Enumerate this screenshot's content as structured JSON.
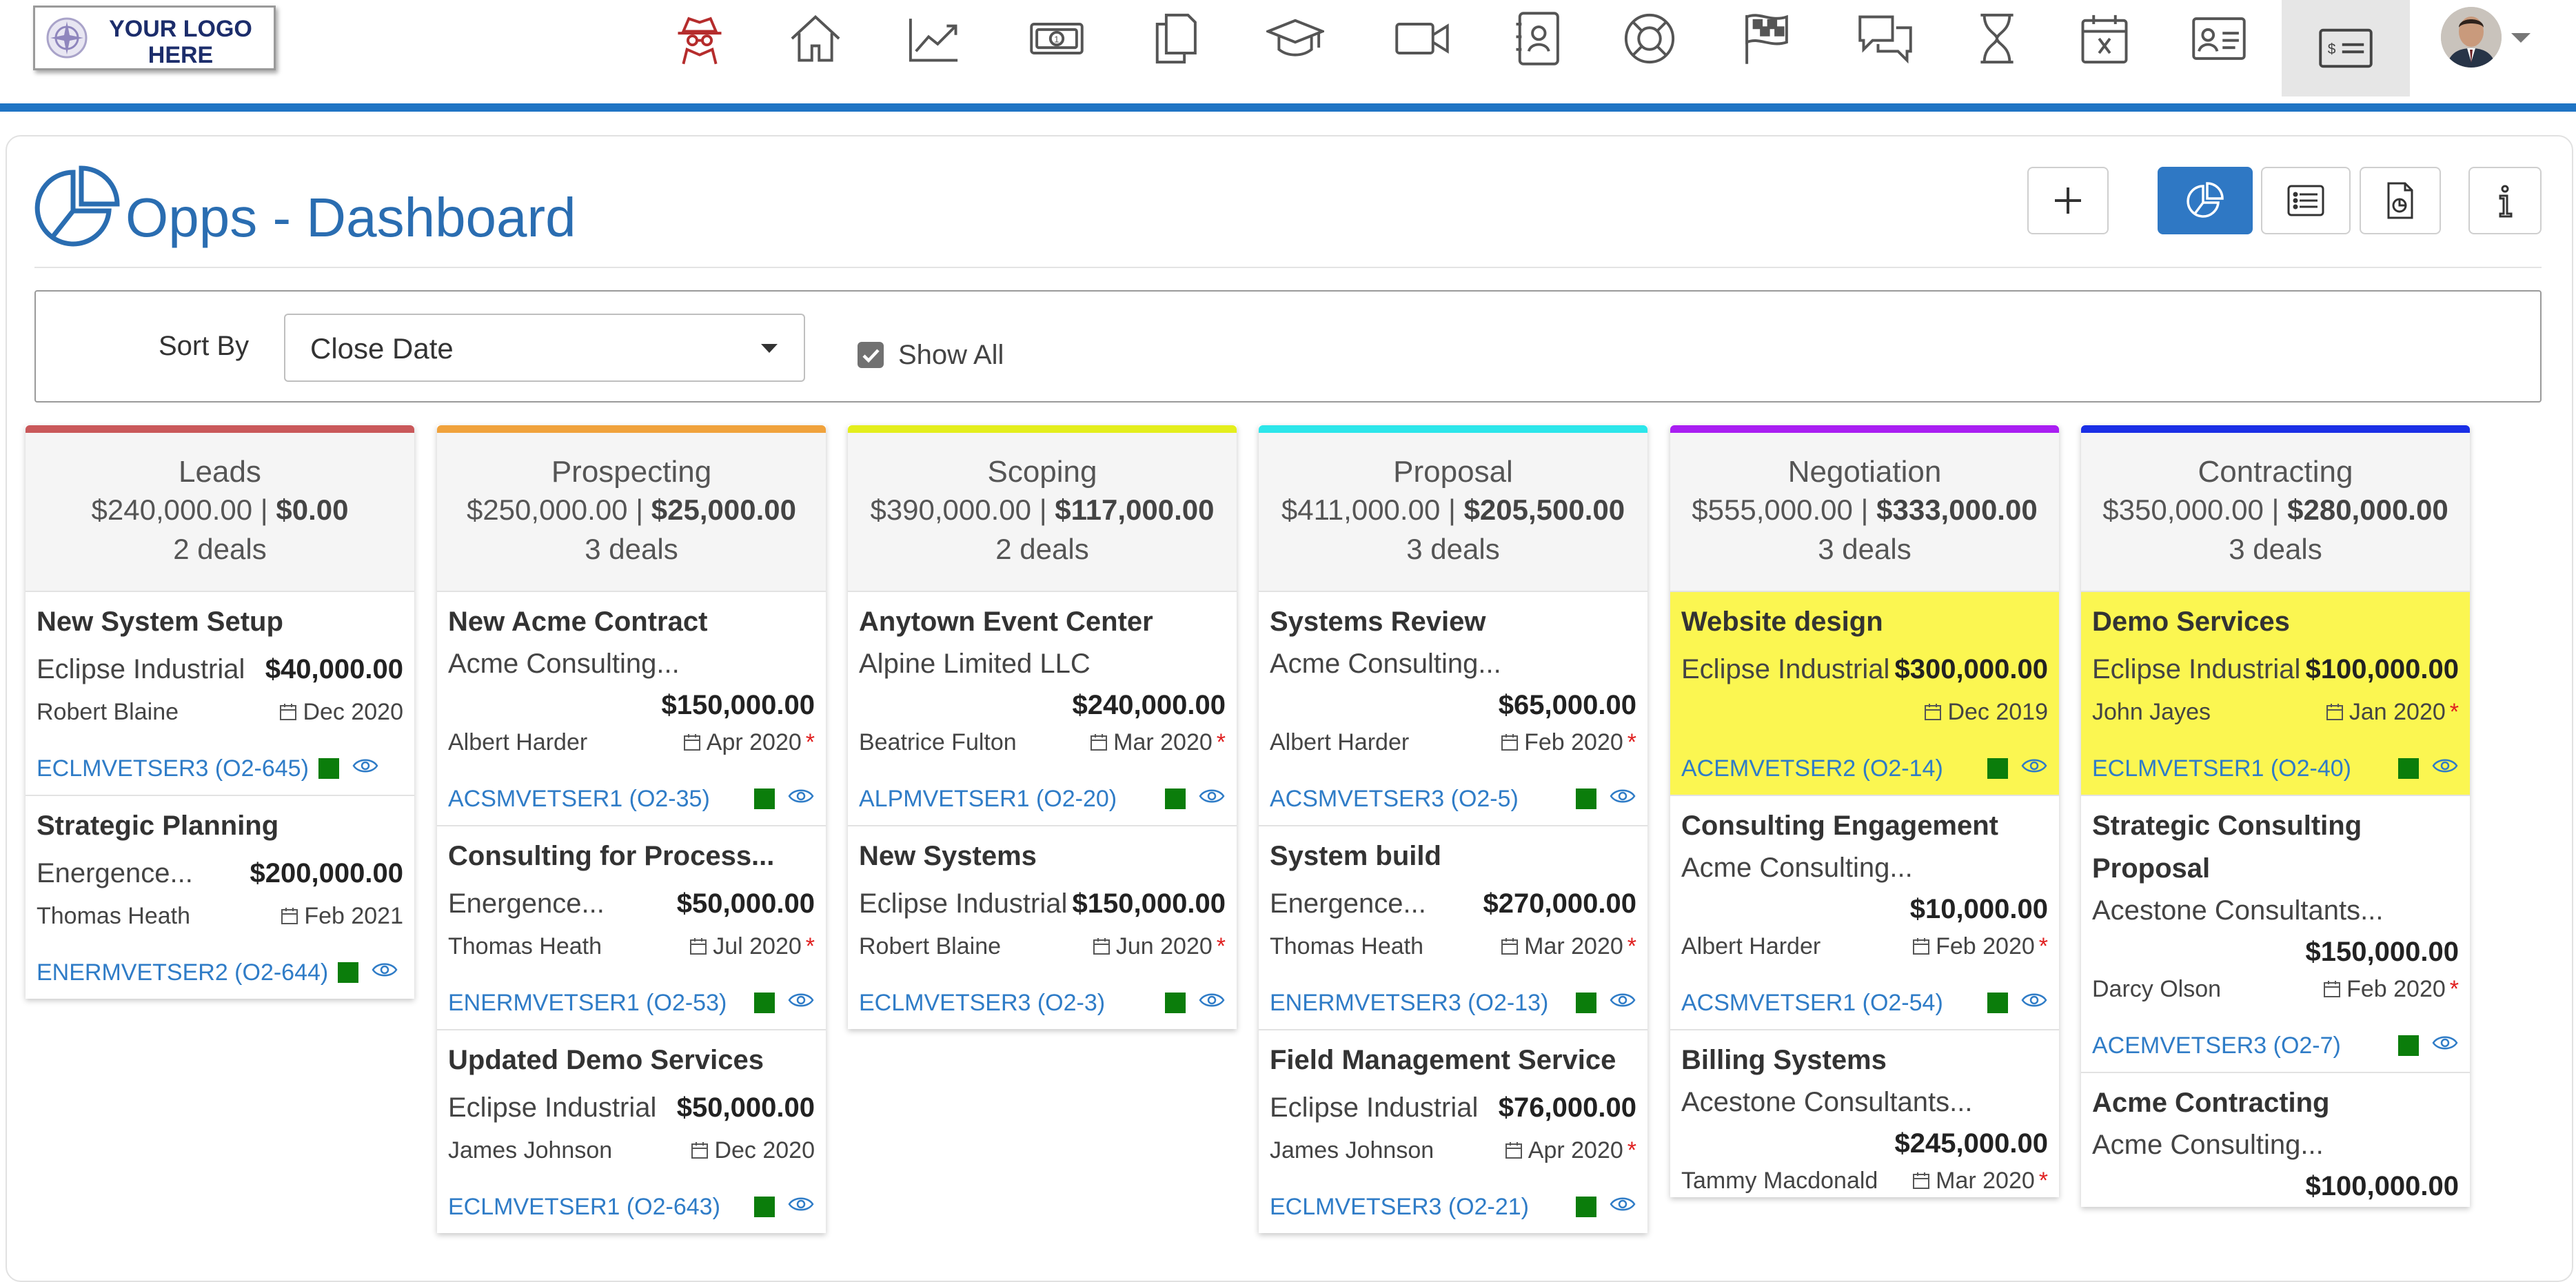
{
  "logo": {
    "line1": "YOUR LOGO",
    "line2": "HERE"
  },
  "nav": [
    {
      "name": "spy-icon"
    },
    {
      "name": "home-icon"
    },
    {
      "name": "trend-chart-icon"
    },
    {
      "name": "money-icon"
    },
    {
      "name": "documents-icon"
    },
    {
      "name": "graduation-cap-icon"
    },
    {
      "name": "video-camera-icon"
    },
    {
      "name": "contact-book-icon"
    },
    {
      "name": "lifebuoy-icon"
    },
    {
      "name": "checkered-flag-icon"
    },
    {
      "name": "chat-icon"
    },
    {
      "name": "hourglass-icon"
    },
    {
      "name": "calendar-x-icon"
    },
    {
      "name": "id-card-icon"
    },
    {
      "name": "opportunities-icon"
    }
  ],
  "page": {
    "title": "Opps - Dashboard"
  },
  "filters": {
    "sort_label": "Sort By",
    "sort_value": "Close Date",
    "show_all_label": "Show All",
    "show_all_checked": true
  },
  "colors": {
    "accent": "#2f78c4",
    "highlight": "#fbf651",
    "leads": "#c9585a",
    "prospecting": "#f0a23c",
    "scoping": "#e4ee1c",
    "proposal": "#2ce6ea",
    "negotiation": "#a91ef2",
    "contracting": "#1a2fe6"
  },
  "columns": [
    {
      "name": "Leads",
      "total": "$240,000.00",
      "weighted": "$0.00",
      "deals": "2 deals",
      "cards": [
        {
          "title": "New System Setup",
          "company": "Eclipse Industrial",
          "amount": "$40,000.00",
          "owner": "Robert Blaine",
          "date": "Dec 2020",
          "code": "ECLMVETSER3 (O2-645)"
        },
        {
          "title": "Strategic Planning",
          "company": "Energence...",
          "amount": "$200,000.00",
          "owner": "Thomas Heath",
          "date": "Feb 2021",
          "code": "ENERMVETSER2 (O2-644)"
        }
      ]
    },
    {
      "name": "Prospecting",
      "total": "$250,000.00",
      "weighted": "$25,000.00",
      "deals": "3 deals",
      "cards": [
        {
          "title": "New Acme Contract",
          "company": "Acme Consulting...",
          "amount": "$150,000.00",
          "owner": "Albert Harder",
          "date": "Apr 2020",
          "code": "ACSMVETSER1 (O2-35)"
        },
        {
          "title": "Consulting for Process...",
          "company": "Energence...",
          "amount": "$50,000.00",
          "owner": "Thomas Heath",
          "date": "Jul 2020",
          "code": "ENERMVETSER1 (O2-53)"
        },
        {
          "title": "Updated Demo Services",
          "company": "Eclipse Industrial",
          "amount": "$50,000.00",
          "owner": "James Johnson",
          "date": "Dec 2020",
          "code": "ECLMVETSER1 (O2-643)"
        }
      ]
    },
    {
      "name": "Scoping",
      "total": "$390,000.00",
      "weighted": "$117,000.00",
      "deals": "2 deals",
      "cards": [
        {
          "title": "Anytown Event Center",
          "company": "Alpine Limited LLC",
          "amount": "$240,000.00",
          "owner": "Beatrice Fulton",
          "date": "Mar 2020",
          "code": "ALPMVETSER1 (O2-20)"
        },
        {
          "title": "New Systems",
          "company": "Eclipse Industrial",
          "amount": "$150,000.00",
          "owner": "Robert Blaine",
          "date": "Jun 2020",
          "code": "ECLMVETSER3 (O2-3)"
        }
      ]
    },
    {
      "name": "Proposal",
      "total": "$411,000.00",
      "weighted": "$205,500.00",
      "deals": "3 deals",
      "cards": [
        {
          "title": "Systems Review",
          "company": "Acme Consulting...",
          "amount": "$65,000.00",
          "owner": "Albert Harder",
          "date": "Feb 2020",
          "code": "ACSMVETSER3 (O2-5)"
        },
        {
          "title": "System build",
          "company": "Energence...",
          "amount": "$270,000.00",
          "owner": "Thomas Heath",
          "date": "Mar 2020",
          "code": "ENERMVETSER3 (O2-13)"
        },
        {
          "title": "Field Management Service",
          "company": "Eclipse Industrial",
          "amount": "$76,000.00",
          "owner": "James Johnson",
          "date": "Apr 2020",
          "code": "ECLMVETSER3 (O2-21)"
        }
      ]
    },
    {
      "name": "Negotiation",
      "total": "$555,000.00",
      "weighted": "$333,000.00",
      "deals": "3 deals",
      "cards": [
        {
          "title": "Website design",
          "company": "Eclipse Industrial",
          "amount": "$300,000.00",
          "owner": "",
          "date": "Dec 2019",
          "code": "ACEMVETSER2 (O2-14)"
        },
        {
          "title": "Consulting Engagement",
          "company": "Acme Consulting...",
          "amount": "$10,000.00",
          "owner": "Albert Harder",
          "date": "Feb 2020",
          "code": "ACSMVETSER1 (O2-54)"
        },
        {
          "title": "Billing Systems",
          "company": "Acestone Consultants...",
          "amount": "$245,000.00",
          "owner": "Tammy Macdonald",
          "date": "Mar 2020",
          "code": ""
        }
      ]
    },
    {
      "name": "Contracting",
      "total": "$350,000.00",
      "weighted": "$280,000.00",
      "deals": "3 deals",
      "cards": [
        {
          "title": "Demo Services",
          "company": "Eclipse Industrial",
          "amount": "$100,000.00",
          "owner": "John Jayes",
          "date": "Jan 2020",
          "code": "ECLMVETSER1 (O2-40)"
        },
        {
          "title": "Strategic Consulting Proposal",
          "company": "Acestone Consultants...",
          "amount": "$150,000.00",
          "owner": "Darcy Olson",
          "date": "Feb 2020",
          "code": "ACEMVETSER3 (O2-7)"
        },
        {
          "title": "Acme Contracting",
          "company": "Acme Consulting...",
          "amount": "$100,000.00",
          "owner": "",
          "date": "",
          "code": ""
        }
      ]
    }
  ]
}
